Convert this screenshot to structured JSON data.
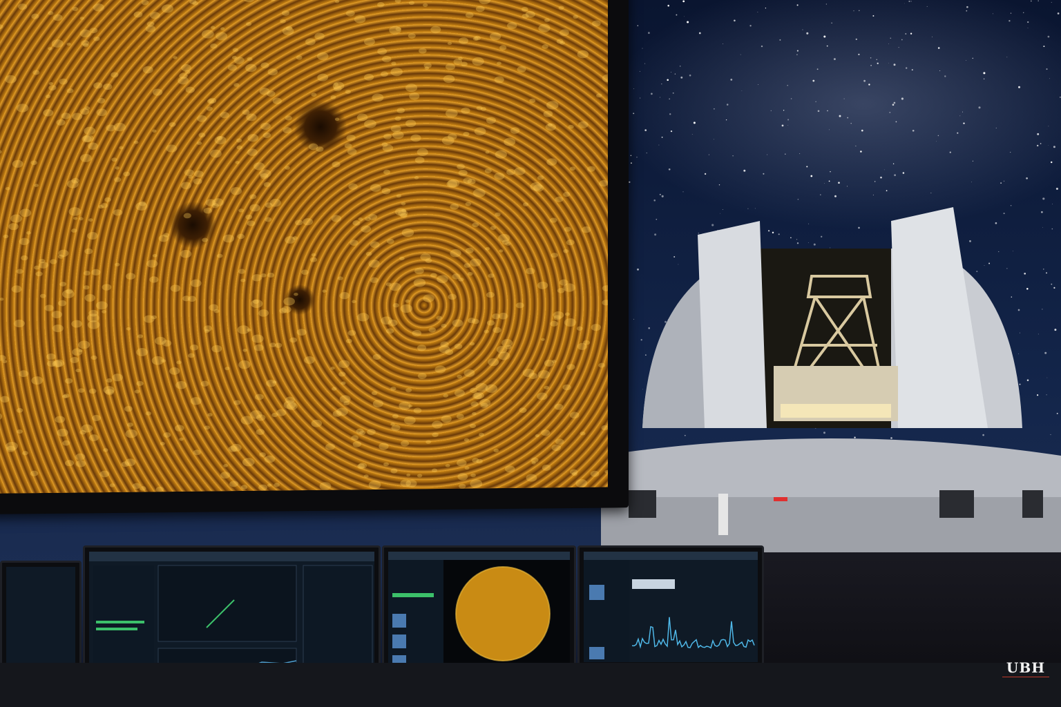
{
  "logo": {
    "text": "UBH"
  },
  "colors": {
    "sky": "#0a1530",
    "sun": "#e39a22",
    "accent": "#c0392b"
  },
  "scene_elements": [
    "solar-surface-display",
    "observatory-dome",
    "telescope",
    "control-monitors",
    "milky-way-sky"
  ]
}
